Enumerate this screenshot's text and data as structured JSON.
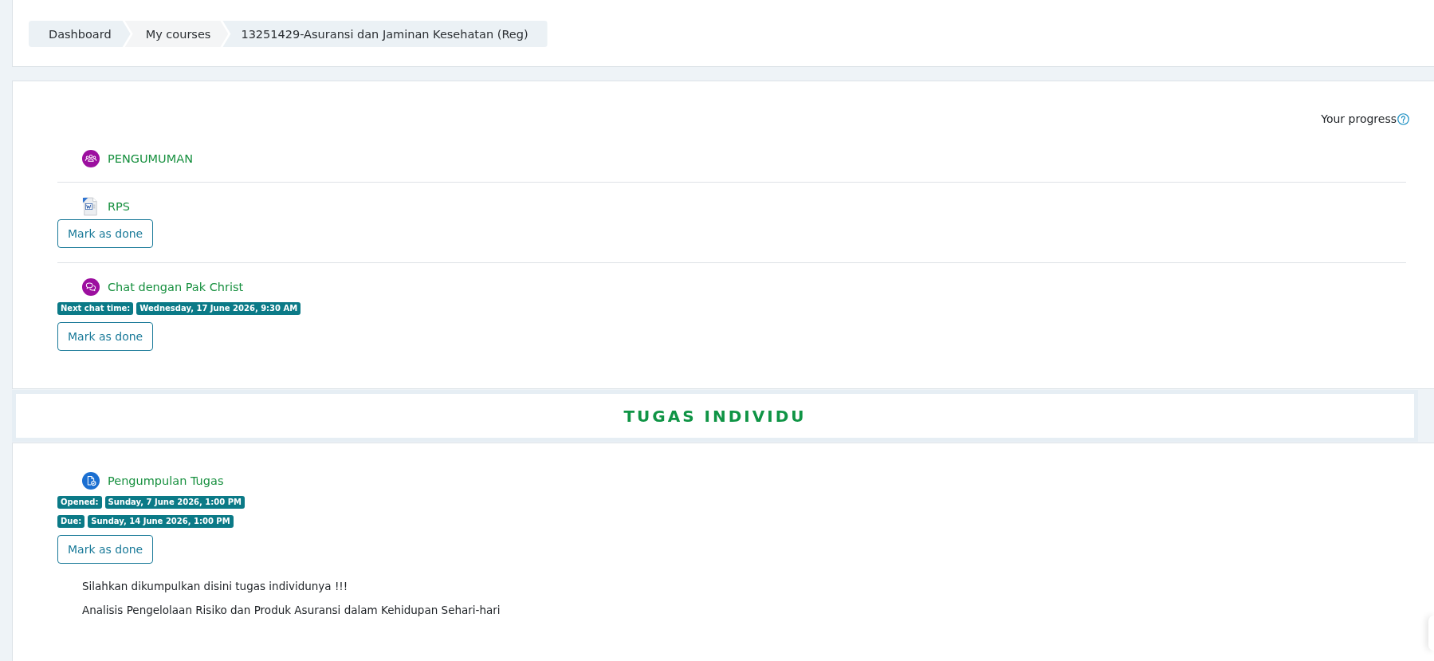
{
  "breadcrumb": [
    {
      "label": "Dashboard",
      "kind": "link"
    },
    {
      "label": "My courses",
      "kind": "text"
    },
    {
      "label": "13251429-Asuransi dan Jaminan Kesehatan (Reg)",
      "kind": "link"
    }
  ],
  "progress": {
    "label": "Your progress"
  },
  "sections": [
    {
      "activities": [
        {
          "kind": "forum",
          "name": "PENGUMUMAN"
        },
        {
          "kind": "file",
          "name": "RPS",
          "completion_button": "Mark as done"
        },
        {
          "kind": "chat",
          "name": "Chat dengan Pak Christ",
          "dates": [
            {
              "label": "Next chat time:",
              "value": "Wednesday, 17 June 2026, 9:30 AM"
            }
          ],
          "completion_button": "Mark as done"
        }
      ]
    },
    {
      "title": "TUGAS INDIVIDU",
      "activities": [
        {
          "kind": "assign",
          "name": "Pengumpulan Tugas",
          "dates": [
            {
              "label": "Opened:",
              "value": "Sunday, 7 June 2026, 1:00 PM"
            },
            {
              "label": "Due:",
              "value": "Sunday, 14 June 2026, 1:00 PM"
            }
          ],
          "completion_button": "Mark as done",
          "description": [
            "Silahkan dikumpulkan disini tugas individunya !!!",
            "Analisis Pengelolaan Risiko dan Produk Asuransi dalam Kehidupan Sehari-hari"
          ]
        }
      ]
    }
  ]
}
